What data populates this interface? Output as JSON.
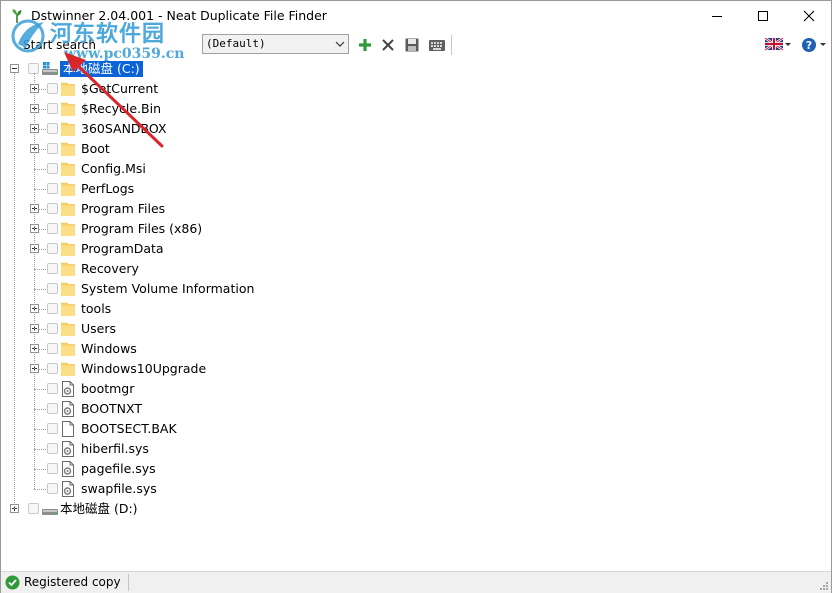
{
  "window": {
    "title": "Dstwinner 2.04.001 - Neat Duplicate File Finder"
  },
  "watermark": {
    "title": "河东软件园",
    "url": "www.pc0359.cn"
  },
  "toolbar": {
    "start_search_label": "Start search",
    "profile_value": "(Default)",
    "add_icon": "plus-icon",
    "remove_icon": "x-icon",
    "save_icon": "floppy-icon",
    "keyboard_icon": "keyboard-icon",
    "language_icon": "uk-flag-icon",
    "help_icon": "help-icon"
  },
  "tree": {
    "drives": [
      {
        "label": "本地磁盘 (C:)",
        "selected": true,
        "expanded": true,
        "children": [
          {
            "label": "$GetCurrent",
            "type": "folder",
            "expandable": true
          },
          {
            "label": "$Recycle.Bin",
            "type": "folder",
            "expandable": true
          },
          {
            "label": "360SANDBOX",
            "type": "folder",
            "expandable": true
          },
          {
            "label": "Boot",
            "type": "folder",
            "expandable": true
          },
          {
            "label": "Config.Msi",
            "type": "folder",
            "expandable": false
          },
          {
            "label": "PerfLogs",
            "type": "folder",
            "expandable": false
          },
          {
            "label": "Program Files",
            "type": "folder",
            "expandable": true
          },
          {
            "label": "Program Files (x86)",
            "type": "folder",
            "expandable": true
          },
          {
            "label": "ProgramData",
            "type": "folder",
            "expandable": true
          },
          {
            "label": "Recovery",
            "type": "folder",
            "expandable": false
          },
          {
            "label": "System Volume Information",
            "type": "folder",
            "expandable": false
          },
          {
            "label": "tools",
            "type": "folder",
            "expandable": true
          },
          {
            "label": "Users",
            "type": "folder",
            "expandable": true
          },
          {
            "label": "Windows",
            "type": "folder",
            "expandable": true
          },
          {
            "label": "Windows10Upgrade",
            "type": "folder",
            "expandable": true
          },
          {
            "label": "bootmgr",
            "type": "sysfile",
            "expandable": false
          },
          {
            "label": "BOOTNXT",
            "type": "sysfile",
            "expandable": false
          },
          {
            "label": "BOOTSECT.BAK",
            "type": "file",
            "expandable": false
          },
          {
            "label": "hiberfil.sys",
            "type": "sysfile",
            "expandable": false
          },
          {
            "label": "pagefile.sys",
            "type": "sysfile",
            "expandable": false
          },
          {
            "label": "swapfile.sys",
            "type": "sysfile",
            "expandable": false
          }
        ]
      },
      {
        "label": "本地磁盘 (D:)",
        "selected": false,
        "expanded": false,
        "children": []
      }
    ]
  },
  "statusbar": {
    "text": "Registered copy"
  },
  "colors": {
    "selection": "#0a64d8",
    "folder": "#f9d46b",
    "accent_green": "#2f9a3a",
    "annotation_arrow": "#d8262b"
  }
}
